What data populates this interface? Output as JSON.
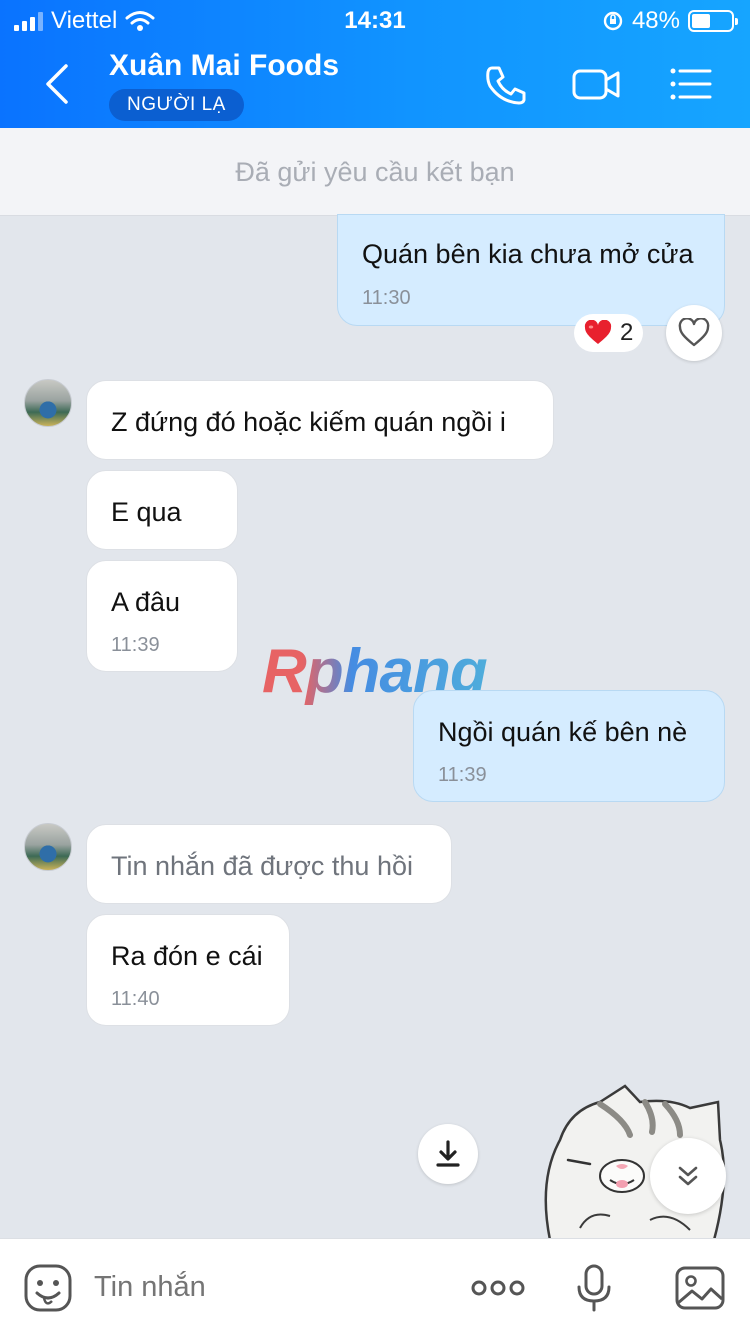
{
  "status_bar": {
    "carrier": "Viettel",
    "time": "14:31",
    "battery": "48%"
  },
  "header": {
    "contact_name": "Xuân Mai Foods",
    "badge": "NGƯỜI LẠ",
    "icons": [
      "back-arrow-icon",
      "phone-icon",
      "video-call-icon",
      "menu-list-icon"
    ]
  },
  "friend_request": {
    "text": "Đã gửi yêu cầu kết bạn"
  },
  "messages": [
    {
      "side": "out",
      "text": "Quán bên kia chưa mở cửa",
      "time": "11:30",
      "reaction_count": "2",
      "reaction_icon": "heart-icon"
    },
    {
      "side": "in",
      "text": "Z đứng đó hoặc kiếm quán ngồi i"
    },
    {
      "side": "in",
      "text": "E qua"
    },
    {
      "side": "in",
      "text": "A đâu",
      "time": "11:39"
    },
    {
      "side": "out",
      "text": "Ngồi quán kế bên nè",
      "time": "11:39"
    },
    {
      "side": "in",
      "text": "Tin nhắn đã được thu hồi",
      "recalled": true
    },
    {
      "side": "in",
      "text": "Ra đón e cái",
      "time": "11:40"
    }
  ],
  "watermark": "Rphang",
  "composer": {
    "placeholder": "Tin nhắn",
    "icons": [
      "emoji-icon",
      "more-dots-icon",
      "microphone-icon",
      "image-icon"
    ]
  },
  "colors": {
    "header_blue": "#0a73ff",
    "outgoing_bubble": "#d5ecff",
    "chat_background": "#e2e6ec"
  }
}
